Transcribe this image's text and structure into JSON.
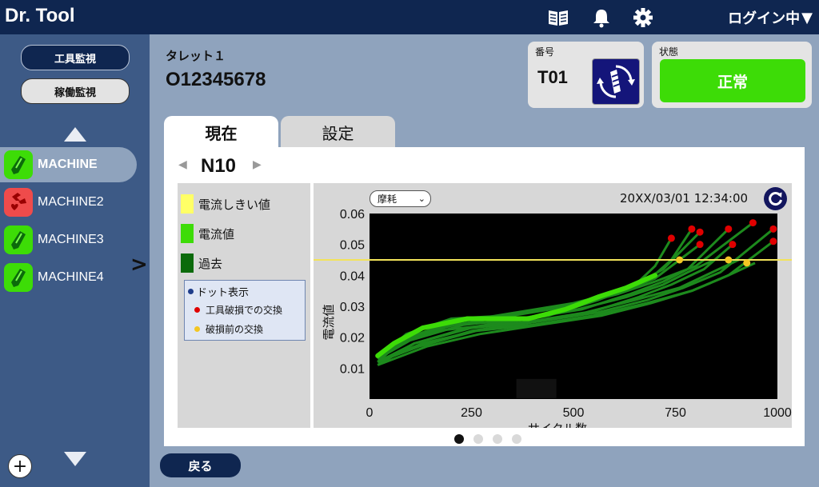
{
  "app": {
    "title": "Dr. Tool",
    "login_label": "ログイン中"
  },
  "sidebar": {
    "nav_buttons": [
      {
        "label": "工具監視",
        "active": true
      },
      {
        "label": "稼働監視",
        "active": false
      }
    ],
    "machines": [
      {
        "name": "MACHINE",
        "status": "ok",
        "selected": true
      },
      {
        "name": "MACHINE2",
        "status": "broken",
        "selected": false
      },
      {
        "name": "MACHINE3",
        "status": "ok",
        "selected": false
      },
      {
        "name": "MACHINE4",
        "status": "ok",
        "selected": false
      }
    ],
    "add_label": "+"
  },
  "turret": {
    "label": "タレット１",
    "id": "O12345678"
  },
  "tool_card": {
    "label": "番号",
    "tool_no": "T01"
  },
  "state_card": {
    "label": "状態",
    "status": "正常",
    "color": "#3ddc07"
  },
  "tabs": [
    {
      "label": "現在",
      "active": true
    },
    {
      "label": "設定",
      "active": false
    }
  ],
  "nav": {
    "prev": "◀",
    "label": "N10",
    "next": "▶"
  },
  "legend": {
    "items": [
      {
        "label": "電流しきい値",
        "color": "#ffff66"
      },
      {
        "label": "電流値",
        "color": "#3ddc07"
      },
      {
        "label": "過去",
        "color": "#0b6a0b"
      }
    ],
    "dot_title": "ドット表示",
    "dots": [
      {
        "label": "工具破損での交換",
        "color": "#e00000"
      },
      {
        "label": "破損前の交換",
        "color": "#f3c623"
      }
    ]
  },
  "chart_controls": {
    "select_value": "摩耗",
    "timestamp": "20XX/03/01 12:34:00"
  },
  "chart_data": {
    "type": "line",
    "xlabel": "サイクル数",
    "ylabel": "電流値",
    "xlim": [
      0,
      1000
    ],
    "ylim": [
      0.0,
      0.06
    ],
    "xticks": [
      0,
      250,
      500,
      750,
      1000
    ],
    "yticks": [
      0.01,
      0.02,
      0.03,
      0.04,
      0.05,
      0.06
    ],
    "threshold": 0.045,
    "current": {
      "x": [
        20,
        60,
        130,
        240,
        390,
        480,
        560,
        630,
        700
      ],
      "y": [
        0.014,
        0.018,
        0.023,
        0.026,
        0.026,
        0.029,
        0.033,
        0.036,
        0.04
      ]
    },
    "past": [
      {
        "x": [
          20,
          80,
          180,
          320,
          460,
          580,
          660,
          700,
          740
        ],
        "y": [
          0.012,
          0.019,
          0.024,
          0.025,
          0.028,
          0.033,
          0.038,
          0.043,
          0.052
        ]
      },
      {
        "x": [
          20,
          90,
          200,
          340,
          480,
          600,
          680,
          740,
          790
        ],
        "y": [
          0.013,
          0.021,
          0.026,
          0.027,
          0.03,
          0.034,
          0.038,
          0.045,
          0.055
        ]
      },
      {
        "x": [
          20,
          70,
          160,
          300,
          440,
          560,
          640,
          720,
          810
        ],
        "y": [
          0.012,
          0.018,
          0.022,
          0.024,
          0.027,
          0.032,
          0.036,
          0.042,
          0.054
        ]
      },
      {
        "x": [
          20,
          100,
          220,
          360,
          500,
          620,
          700,
          760,
          810
        ],
        "y": [
          0.013,
          0.02,
          0.025,
          0.028,
          0.031,
          0.035,
          0.039,
          0.045,
          0.05
        ]
      },
      {
        "x": [
          20,
          110,
          240,
          380,
          520,
          640,
          720,
          780,
          880
        ],
        "y": [
          0.011,
          0.018,
          0.023,
          0.026,
          0.029,
          0.034,
          0.038,
          0.042,
          0.055
        ]
      },
      {
        "x": [
          20,
          120,
          250,
          400,
          540,
          660,
          740,
          820,
          890
        ],
        "y": [
          0.012,
          0.017,
          0.022,
          0.025,
          0.028,
          0.033,
          0.037,
          0.042,
          0.05
        ]
      },
      {
        "x": [
          20,
          90,
          210,
          350,
          490,
          610,
          700,
          800,
          940
        ],
        "y": [
          0.013,
          0.02,
          0.024,
          0.027,
          0.03,
          0.034,
          0.038,
          0.043,
          0.057
        ]
      },
      {
        "x": [
          20,
          130,
          260,
          410,
          560,
          680,
          770,
          860,
          990
        ],
        "y": [
          0.012,
          0.018,
          0.022,
          0.025,
          0.028,
          0.032,
          0.036,
          0.041,
          0.055
        ]
      },
      {
        "x": [
          20,
          140,
          270,
          420,
          570,
          690,
          790,
          880,
          990
        ],
        "y": [
          0.011,
          0.017,
          0.021,
          0.024,
          0.027,
          0.031,
          0.035,
          0.04,
          0.051
        ]
      },
      {
        "x": [
          20,
          100,
          230,
          370,
          510,
          630,
          720,
          780,
          845
        ],
        "y": [
          0.013,
          0.019,
          0.024,
          0.026,
          0.029,
          0.033,
          0.037,
          0.041,
          0.045
        ]
      },
      {
        "x": [
          20,
          110,
          250,
          390,
          530,
          650,
          760,
          840,
          905
        ],
        "y": [
          0.012,
          0.018,
          0.023,
          0.025,
          0.028,
          0.032,
          0.036,
          0.041,
          0.045
        ]
      },
      {
        "x": [
          20,
          120,
          260,
          400,
          550,
          680,
          790,
          880,
          945
        ],
        "y": [
          0.012,
          0.017,
          0.022,
          0.024,
          0.027,
          0.031,
          0.035,
          0.04,
          0.044
        ]
      }
    ],
    "red_points": [
      {
        "x": 740,
        "y": 0.052
      },
      {
        "x": 790,
        "y": 0.055
      },
      {
        "x": 810,
        "y": 0.054
      },
      {
        "x": 810,
        "y": 0.05
      },
      {
        "x": 880,
        "y": 0.055
      },
      {
        "x": 890,
        "y": 0.05
      },
      {
        "x": 940,
        "y": 0.057
      },
      {
        "x": 990,
        "y": 0.055
      },
      {
        "x": 990,
        "y": 0.051
      }
    ],
    "yellow_points": [
      {
        "x": 760,
        "y": 0.045
      },
      {
        "x": 880,
        "y": 0.045
      },
      {
        "x": 925,
        "y": 0.044
      }
    ],
    "colors": {
      "threshold": "#f2e35a",
      "current": "#3ddc07",
      "past": "#1d8a1d",
      "red": "#e00000",
      "yellow": "#f3c623"
    }
  },
  "pager": {
    "count": 4,
    "active": 0
  },
  "back_label": "戻る"
}
